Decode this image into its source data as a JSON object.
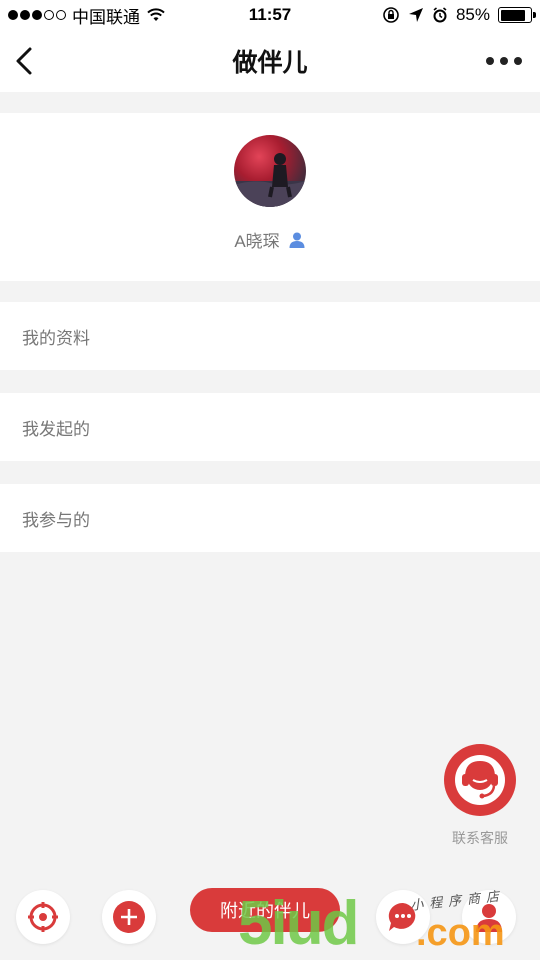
{
  "status_bar": {
    "carrier": "中国联通",
    "time": "11:57",
    "battery_percent": "85%",
    "battery_level": 0.85,
    "signal_bars_filled": 3,
    "signal_bars_total": 5,
    "icons": [
      "wifi-icon",
      "rotation-lock-icon",
      "location-arrow-icon",
      "alarm-icon",
      "battery-icon"
    ]
  },
  "nav": {
    "title": "做伴儿",
    "back_icon": "chevron-left-icon",
    "more_icon": "more-horizontal-icon"
  },
  "profile": {
    "username": "A晓琛",
    "user_icon": "person-icon"
  },
  "menu": {
    "items": [
      {
        "label": "我的资料"
      },
      {
        "label": "我发起的"
      },
      {
        "label": "我参与的"
      }
    ]
  },
  "customer_service": {
    "label": "联系客服",
    "icon": "headset-agent-icon"
  },
  "toolbar": {
    "nearby_label": "附近的伴儿",
    "locate_icon": "crosshair-icon",
    "add_icon": "plus-icon",
    "chat_icon": "chat-bubble-icon",
    "profile_icon": "person-icon"
  },
  "watermark": {
    "main": "5iud",
    "suffix": ".com",
    "script": "小程序商店"
  },
  "colors": {
    "accent": "#d93b3b",
    "background": "#f3f3f3",
    "card": "#ffffff",
    "muted_text": "#777777",
    "user_icon": "#5b8de0"
  }
}
